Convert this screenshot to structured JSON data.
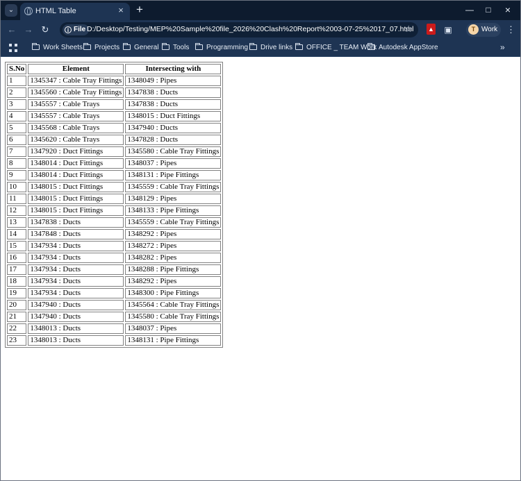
{
  "browser": {
    "tab": {
      "title": "HTML Table"
    },
    "address": {
      "scheme_label": "File",
      "url": "D:/Desktop/Testing/MEP%20Sample%20file_2026%20Clash%20Report%2003-07-25%2017_07.html"
    },
    "profile": {
      "initial": "T",
      "label": "Work"
    },
    "bookmarks": [
      {
        "label": "Work Sheets"
      },
      {
        "label": "Projects"
      },
      {
        "label": "General"
      },
      {
        "label": "Tools"
      },
      {
        "label": "Programming"
      },
      {
        "label": "Drive links"
      },
      {
        "label": "OFFICE _ TEAM Work"
      },
      {
        "label": "Autodesk AppStore"
      }
    ],
    "icons": {
      "tab_menu": "chevron-down-icon",
      "favicon": "globe-icon",
      "close": "close-icon",
      "new_tab": "plus-icon",
      "back": "arrow-left-icon",
      "forward": "arrow-right-icon",
      "reload": "reload-icon",
      "info": "info-icon",
      "star": "star-icon",
      "pdf": "pdf-extension-icon",
      "extensions": "puzzle-icon",
      "menu": "kebab-menu-icon",
      "apps": "apps-grid-icon",
      "folder": "folder-icon",
      "more": "chevron-double-right-icon"
    },
    "colors": {
      "frame": "#0d1b2e",
      "toolbar": "#1e3453",
      "pdf": "#cc1b1b"
    }
  },
  "table": {
    "headers": [
      "S.No",
      "Element",
      "Intersecting with"
    ],
    "rows": [
      [
        "1",
        "1345347 : Cable Tray Fittings",
        "1348049 : Pipes"
      ],
      [
        "2",
        "1345560 : Cable Tray Fittings",
        "1347838 : Ducts"
      ],
      [
        "3",
        "1345557 : Cable Trays",
        "1347838 : Ducts"
      ],
      [
        "4",
        "1345557 : Cable Trays",
        "1348015 : Duct Fittings"
      ],
      [
        "5",
        "1345568 : Cable Trays",
        "1347940 : Ducts"
      ],
      [
        "6",
        "1345620 : Cable Trays",
        "1347828 : Ducts"
      ],
      [
        "7",
        "1347920 : Duct Fittings",
        "1345580 : Cable Tray Fittings"
      ],
      [
        "8",
        "1348014 : Duct Fittings",
        "1348037 : Pipes"
      ],
      [
        "9",
        "1348014 : Duct Fittings",
        "1348131 : Pipe Fittings"
      ],
      [
        "10",
        "1348015 : Duct Fittings",
        "1345559 : Cable Tray Fittings"
      ],
      [
        "11",
        "1348015 : Duct Fittings",
        "1348129 : Pipes"
      ],
      [
        "12",
        "1348015 : Duct Fittings",
        "1348133 : Pipe Fittings"
      ],
      [
        "13",
        "1347838 : Ducts",
        "1345559 : Cable Tray Fittings"
      ],
      [
        "14",
        "1347848 : Ducts",
        "1348292 : Pipes"
      ],
      [
        "15",
        "1347934 : Ducts",
        "1348272 : Pipes"
      ],
      [
        "16",
        "1347934 : Ducts",
        "1348282 : Pipes"
      ],
      [
        "17",
        "1347934 : Ducts",
        "1348288 : Pipe Fittings"
      ],
      [
        "18",
        "1347934 : Ducts",
        "1348292 : Pipes"
      ],
      [
        "19",
        "1347934 : Ducts",
        "1348300 : Pipe Fittings"
      ],
      [
        "20",
        "1347940 : Ducts",
        "1345564 : Cable Tray Fittings"
      ],
      [
        "21",
        "1347940 : Ducts",
        "1345580 : Cable Tray Fittings"
      ],
      [
        "22",
        "1348013 : Ducts",
        "1348037 : Pipes"
      ],
      [
        "23",
        "1348013 : Ducts",
        "1348131 : Pipe Fittings"
      ]
    ]
  }
}
